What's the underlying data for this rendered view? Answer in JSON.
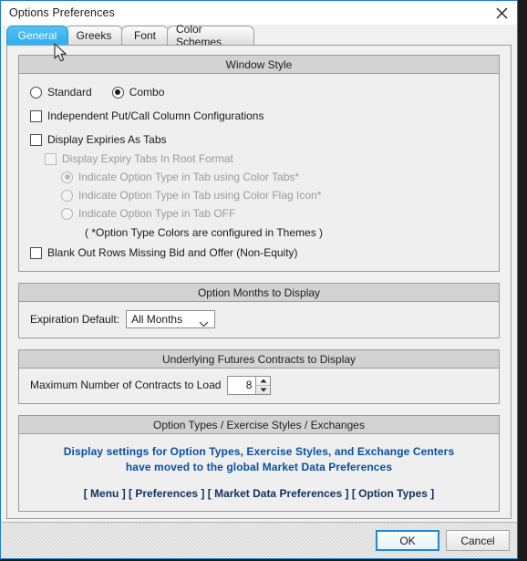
{
  "window": {
    "title": "Options Preferences",
    "close_icon": "close-icon"
  },
  "tabs": [
    {
      "label": "General",
      "active": true
    },
    {
      "label": "Greeks",
      "active": false
    },
    {
      "label": "Font",
      "active": false
    },
    {
      "label": "Color Schemes",
      "active": false
    }
  ],
  "window_style": {
    "header": "Window Style",
    "radios": [
      {
        "label": "Standard",
        "checked": false
      },
      {
        "label": "Combo",
        "checked": true
      }
    ],
    "checkbox_independent": {
      "label": "Independent Put/Call Column Configurations",
      "checked": false
    },
    "checkbox_expiries_tabs": {
      "label": "Display Expiries As Tabs",
      "checked": false
    },
    "checkbox_root_format": {
      "label": "Display Expiry Tabs In Root Format",
      "checked": false,
      "disabled": true
    },
    "tab_type_radios": [
      {
        "label": "Indicate Option Type in Tab using Color Tabs*",
        "checked": true,
        "disabled": true
      },
      {
        "label": "Indicate Option Type in Tab using Color Flag Icon*",
        "checked": false,
        "disabled": true
      },
      {
        "label": "Indicate Option Type in Tab OFF",
        "checked": false,
        "disabled": true
      }
    ],
    "note": "( *Option Type Colors are configured in Themes )",
    "checkbox_blank_rows": {
      "label": "Blank Out Rows Missing Bid and Offer (Non-Equity)",
      "checked": false
    }
  },
  "option_months": {
    "header": "Option Months to Display",
    "label": "Expiration Default:",
    "value": "All Months",
    "options": [
      "All Months"
    ],
    "chevron_icon": "chevron-down-icon"
  },
  "futures_contracts": {
    "header": "Underlying Futures Contracts to Display",
    "label": "Maximum Number of Contracts to Load",
    "value": "8",
    "up_icon": "spinner-up-icon",
    "down_icon": "spinner-down-icon"
  },
  "option_types_info": {
    "header": "Option Types / Exercise Styles / Exchanges",
    "line1": "Display settings for  Option Types,  Exercise Styles,  and  Exchange Centers",
    "line2": "have moved to the global Market Data Preferences",
    "path": "[ Menu ] [ Preferences ] [ Market Data Preferences ] [ Option Types ]"
  },
  "footer": {
    "ok_label": "OK",
    "cancel_label": "Cancel"
  },
  "colors": {
    "accent": "#3cb5f0",
    "window_border": "#1a7ec2",
    "info_text": "#0a4fa0",
    "path_text": "#11315e",
    "default_button_border": "#1f87d8"
  }
}
